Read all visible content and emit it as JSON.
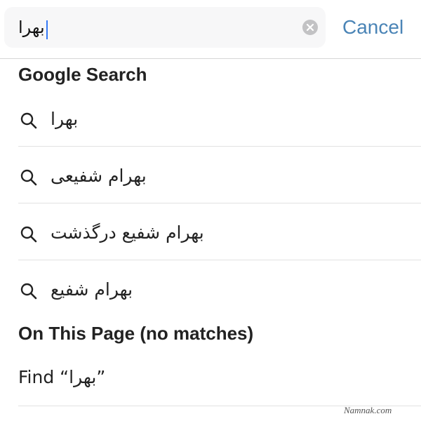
{
  "search": {
    "value": "بهرا"
  },
  "cancel_label": "Cancel",
  "sections": {
    "google_search": "Google Search",
    "on_this_page": "On This Page (no matches)"
  },
  "suggestions": [
    {
      "label": "بهرا",
      "icon": "search-icon"
    },
    {
      "label": "بهرام شفیعی",
      "icon": "search-icon"
    },
    {
      "label": "بهرام شفیع درگذشت",
      "icon": "search-icon"
    },
    {
      "label": "بهرام شفیع",
      "icon": "search-icon"
    }
  ],
  "find": {
    "label": "Find “بهرا”"
  },
  "watermark": "Namnak.com",
  "colors": {
    "accent": "#4a84b6",
    "caret": "#3478f6",
    "field_bg": "#f7f7f8",
    "clear_icon": "#c2c2c4"
  }
}
